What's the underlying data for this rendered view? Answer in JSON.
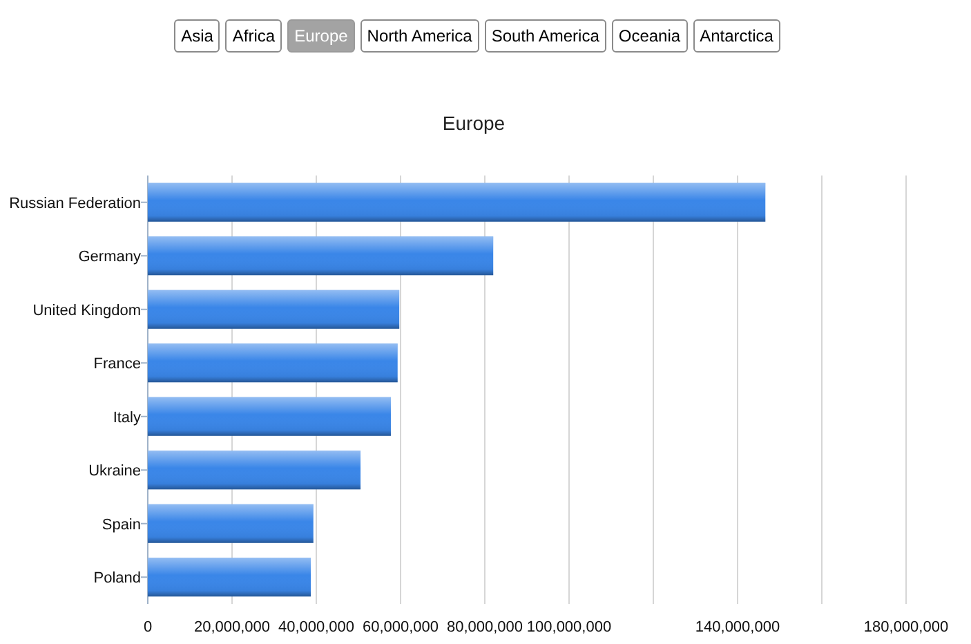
{
  "tabs": [
    {
      "label": "Asia",
      "selected": false
    },
    {
      "label": "Africa",
      "selected": false
    },
    {
      "label": "Europe",
      "selected": true
    },
    {
      "label": "North America",
      "selected": false
    },
    {
      "label": "South America",
      "selected": false
    },
    {
      "label": "Oceania",
      "selected": false
    },
    {
      "label": "Antarctica",
      "selected": false
    }
  ],
  "chart_data": {
    "type": "bar",
    "orientation": "horizontal",
    "title": "Europe",
    "categories": [
      "Russian Federation",
      "Germany",
      "United Kingdom",
      "France",
      "Italy",
      "Ukraine",
      "Spain",
      "Poland"
    ],
    "grid": true,
    "series": [
      {
        "color": "#3a86e8",
        "values": [
          146600000,
          82000000,
          59700000,
          59300000,
          57700000,
          50500000,
          39300000,
          38700000
        ]
      }
    ],
    "xlim": [
      0,
      180000000
    ],
    "xticks": [
      {
        "value": 0,
        "label": "0"
      },
      {
        "value": 20000000,
        "label": "20,000,000"
      },
      {
        "value": 40000000,
        "label": "40,000,000"
      },
      {
        "value": 60000000,
        "label": "60,000,000"
      },
      {
        "value": 80000000,
        "label": "80,000,000"
      },
      {
        "value": 100000000,
        "label": "100,000,000"
      },
      {
        "value": 140000000,
        "label": "140,000,000"
      },
      {
        "value": 180000000,
        "label": "180,000,000"
      }
    ]
  }
}
